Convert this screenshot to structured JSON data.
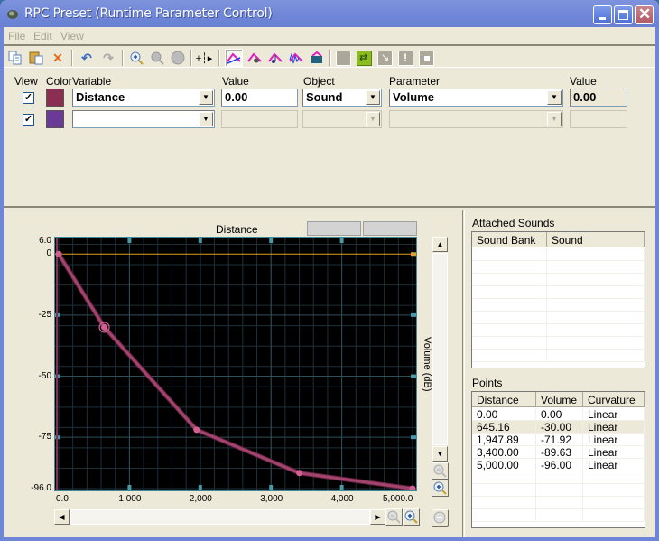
{
  "window": {
    "title": "RPC Preset (Runtime Parameter Control)",
    "controls": [
      "minimize",
      "maximize",
      "close"
    ]
  },
  "menu": [
    "File",
    "Edit",
    "View"
  ],
  "toolbar": {
    "buttons": [
      {
        "name": "copy",
        "icon": "copy-icon"
      },
      {
        "name": "paste",
        "icon": "paste-icon"
      },
      {
        "name": "delete",
        "icon": "delete-icon"
      },
      {
        "name": "undo",
        "icon": "undo-icon"
      },
      {
        "name": "redo",
        "icon": "redo-icon"
      },
      {
        "name": "zoom-in",
        "icon": "zoom-in-icon"
      },
      {
        "name": "zoom-out",
        "icon": "zoom-out-icon"
      },
      {
        "name": "zoom-fit",
        "icon": "zoom-fit-icon"
      },
      {
        "name": "select-point",
        "icon": "cursor-icon"
      },
      {
        "name": "curve-volume",
        "icon": "curve-icon",
        "pressed": true
      },
      {
        "name": "curve-speaker",
        "icon": "speaker-curve-icon"
      },
      {
        "name": "curve-note",
        "icon": "note-curve-icon"
      },
      {
        "name": "curve-wave",
        "icon": "wave-curve-icon"
      },
      {
        "name": "curve-percent",
        "icon": "percent-curve-icon"
      },
      {
        "name": "blank",
        "icon": "blank-icon"
      },
      {
        "name": "attach",
        "icon": "attach-icon"
      },
      {
        "name": "arrow-in",
        "icon": "arrow-in-icon"
      },
      {
        "name": "alert",
        "icon": "exclamation-icon"
      },
      {
        "name": "stop",
        "icon": "stop-icon"
      }
    ]
  },
  "params": {
    "headers": {
      "view": "View",
      "color": "Color",
      "variable": "Variable",
      "value": "Value",
      "object": "Object",
      "parameter": "Parameter",
      "value2": "Value"
    },
    "rows": [
      {
        "view": true,
        "color": "#8b2f52",
        "variable": "Distance",
        "value": "0.00",
        "object": "Sound",
        "parameter": "Volume",
        "out_value": "0.00"
      },
      {
        "view": true,
        "color": "#6a3a96",
        "variable": "",
        "value": "",
        "object": "",
        "parameter": "",
        "out_value": ""
      }
    ]
  },
  "graph": {
    "title": "Distance",
    "ylabel": "Volume (dB)"
  },
  "chart_data": {
    "type": "line",
    "title": "Distance",
    "xlabel": "Distance",
    "ylabel": "Volume (dB)",
    "xlim": [
      0,
      5000
    ],
    "ylim": [
      -96,
      6
    ],
    "x_ticks": [
      "0.0",
      "1,000",
      "2,000",
      "3,000",
      "4,000",
      "5,000.0"
    ],
    "y_ticks": [
      "6.0",
      "0",
      "-25",
      "-50",
      "-75",
      "-96.0"
    ],
    "y_tick_values": [
      6,
      0,
      -25,
      -50,
      -75,
      -96
    ],
    "x_tick_values": [
      0,
      1000,
      2000,
      3000,
      4000,
      5000
    ],
    "grid": true,
    "reference_line": 0,
    "series": [
      {
        "name": "Volume",
        "color": "#a0456e",
        "points": [
          [
            0,
            0
          ],
          [
            645.16,
            -30
          ],
          [
            1947.89,
            -71.92
          ],
          [
            3400,
            -89.63
          ],
          [
            5000,
            -96
          ]
        ],
        "selected_index": 1
      }
    ]
  },
  "attached_sounds": {
    "title": "Attached Sounds",
    "columns": [
      "Sound Bank",
      "Sound"
    ],
    "rows": []
  },
  "points": {
    "title": "Points",
    "columns": [
      "Distance",
      "Volume",
      "Curvature"
    ],
    "rows": [
      [
        "0.00",
        "0.00",
        "Linear"
      ],
      [
        "645.16",
        "-30.00",
        "Linear"
      ],
      [
        "1,947.89",
        "-71.92",
        "Linear"
      ],
      [
        "3,400.00",
        "-89.63",
        "Linear"
      ],
      [
        "5,000.00",
        "-96.00",
        "Linear"
      ]
    ],
    "selected_row": 1
  },
  "colors": {
    "accent_curve": "#a0456e",
    "reference_line": "#e0a020",
    "grid": "#1e2f3a",
    "axis_tick": "#4a98a8"
  }
}
